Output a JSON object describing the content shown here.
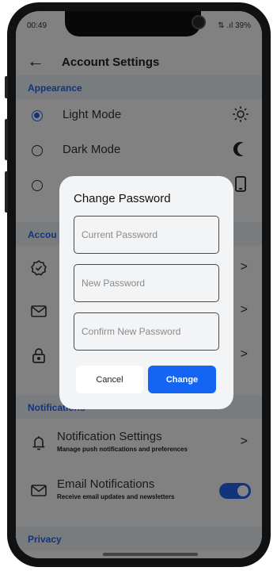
{
  "status_bar": {
    "time": "00:49",
    "right": "⇅ .ıl 39%"
  },
  "appbar": {
    "title": "Account Settings",
    "back_icon": "arrow-left-icon"
  },
  "sections": {
    "appearance": "Appearance",
    "account": "Accou",
    "notifications": "Notifications",
    "privacy": "Privacy"
  },
  "appearance": {
    "options": [
      {
        "label": "Light Mode",
        "selected": true,
        "icon": "sun-icon"
      },
      {
        "label": "Dark Mode",
        "selected": false,
        "icon": "moon-icon"
      },
      {
        "label": "",
        "selected": false,
        "icon": "phone-icon"
      }
    ]
  },
  "account_items": [
    {
      "icon": "verified-badge-icon"
    },
    {
      "icon": "mail-icon"
    },
    {
      "icon": "lock-icon"
    }
  ],
  "notifications": {
    "items": [
      {
        "title": "Notification Settings",
        "subtitle": "Manage push notifications and preferences",
        "icon": "bell-icon"
      },
      {
        "title": "Email Notifications",
        "subtitle": "Receive email updates and newsletters",
        "icon": "mail-icon",
        "toggle_on": true
      }
    ]
  },
  "dialog": {
    "title": "Change Password",
    "current_placeholder": "Current Password",
    "new_placeholder": "New Password",
    "confirm_placeholder": "Confirm New Password",
    "cancel_label": "Cancel",
    "change_label": "Change"
  },
  "colors": {
    "accent": "#2563eb",
    "button": "#1565f5",
    "section_bg": "#e9edf3"
  }
}
